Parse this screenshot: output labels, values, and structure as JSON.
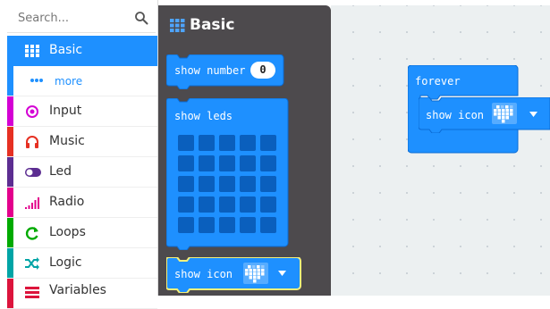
{
  "search": {
    "placeholder": "Search..."
  },
  "toolbox": {
    "categories": [
      {
        "label": "Basic",
        "color": "#1e90ff",
        "icon": "grid-icon"
      },
      {
        "label": "more",
        "color": "#1e90ff",
        "icon": "dots-icon"
      },
      {
        "label": "Input",
        "color": "#d400d4",
        "icon": "target-icon"
      },
      {
        "label": "Music",
        "color": "#e63022",
        "icon": "headphones-icon"
      },
      {
        "label": "Led",
        "color": "#5c2d91",
        "icon": "toggle-icon"
      },
      {
        "label": "Radio",
        "color": "#e3008c",
        "icon": "signal-bars-icon"
      },
      {
        "label": "Loops",
        "color": "#00aa00",
        "icon": "refresh-icon"
      },
      {
        "label": "Logic",
        "color": "#00a4a6",
        "icon": "shuffle-icon"
      },
      {
        "label": "Variables",
        "color": "#dc143c",
        "icon": "list-icon"
      }
    ]
  },
  "flyout": {
    "title": "Basic",
    "blocks": {
      "show_number": {
        "label": "show number",
        "value": "0"
      },
      "show_leds": {
        "label": "show leds"
      },
      "show_icon": {
        "label": "show icon"
      }
    }
  },
  "workspace": {
    "forever": {
      "label": "forever"
    },
    "show_icon": {
      "label": "show icon"
    }
  },
  "colors": {
    "block": "#1e90ff",
    "block_dark": "#0a6bd4",
    "flyout_bg": "#4d4a4d",
    "highlight": "#f4f07a"
  }
}
